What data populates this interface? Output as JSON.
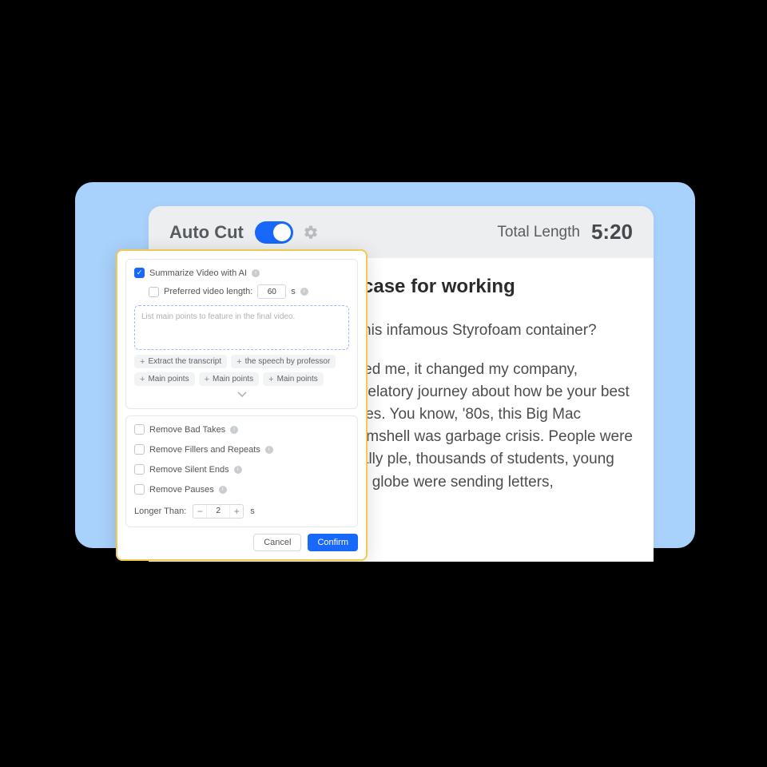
{
  "header": {
    "title": "Auto Cut",
    "toggle_on": true,
    "total_label": "Total Length",
    "total_value": "5:20"
  },
  "content": {
    "heading": "s case for working",
    "question": "s this infamous Styrofoam container?",
    "body": "nged me, it changed my company, revelatory journey about how be your best allies. You know, '80s, this Big Mac clamshell was garbage crisis. People were really ple, thousands of students, young  the globe were sending letters,"
  },
  "popup": {
    "summarize": {
      "checked": true,
      "label": "Summarize Video with AI",
      "pref_label": "Preferred video length:",
      "pref_value": "60",
      "pref_unit": "s",
      "prompt_placeholder": "List main points to feature in the final video."
    },
    "chips": [
      "Extract the transcript",
      "the speech by professor",
      "Main points",
      "Main points",
      "Main points"
    ],
    "options": {
      "bad_takes": "Remove Bad Takes",
      "fillers": "Remove Fillers and Repeats",
      "silent_ends": "Remove Silent Ends",
      "pauses": "Remove Pauses",
      "longer_label": "Longer Than:",
      "longer_value": "2",
      "longer_unit": "s"
    },
    "actions": {
      "cancel": "Cancel",
      "confirm": "Confirm"
    }
  }
}
